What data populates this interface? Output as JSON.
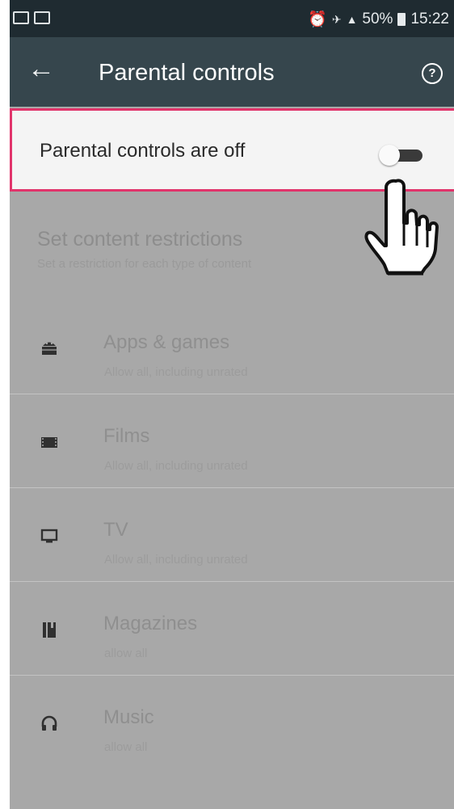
{
  "status_bar": {
    "left_icons": [
      "image-icon",
      "screen-icon"
    ],
    "right_icons": [
      "alarm-icon",
      "wifi-icon",
      "signal-icon",
      "battery-icon"
    ],
    "battery": "50%",
    "time": "15:22"
  },
  "app_bar": {
    "title": "Parental controls",
    "back_icon": "arrow-left-icon",
    "help_icon": "help-circle-icon"
  },
  "toggle": {
    "label": "Parental controls are off",
    "state": "off"
  },
  "restrictions": {
    "title": "Set content restrictions",
    "subtitle": "Set a restriction for each type of content"
  },
  "categories": [
    {
      "name": "Apps & games",
      "desc": "Allow all, including unrated",
      "icon": "android-icon"
    },
    {
      "name": "Films",
      "desc": "Allow all, including unrated",
      "icon": "film-icon"
    },
    {
      "name": "TV",
      "desc": "Allow all, including unrated",
      "icon": "tv-icon"
    },
    {
      "name": "Magazines",
      "desc": "allow all",
      "icon": "magazine-icon"
    },
    {
      "name": "Music",
      "desc": "allow all",
      "icon": "headphones-icon"
    }
  ],
  "colors": {
    "status_bar": "#1f2b31",
    "app_bar": "#36464d",
    "highlight_border": "#e1346b",
    "overlay": "#a8a8a8"
  },
  "cursor": "hand-pointer-icon"
}
